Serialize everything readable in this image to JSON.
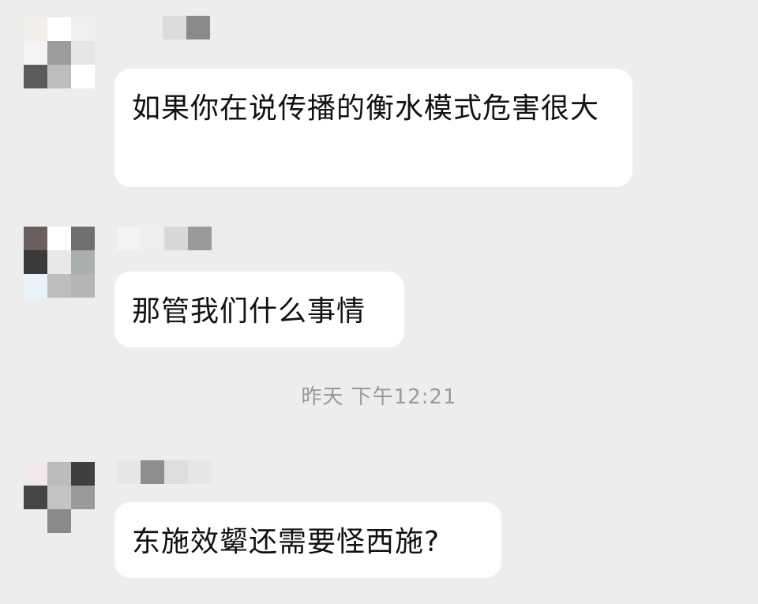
{
  "messages": [
    {
      "text": "如果你在说传播的衡水模式危害很大"
    },
    {
      "text": "那管我们什么事情"
    },
    {
      "text": "东施效颦还需要怪西施?"
    }
  ],
  "timestamp": "昨天 下午12:21",
  "colors": {
    "background": "#ededed",
    "bubble": "#ffffff",
    "text": "#111111",
    "timestamp": "#9a9a9a"
  }
}
